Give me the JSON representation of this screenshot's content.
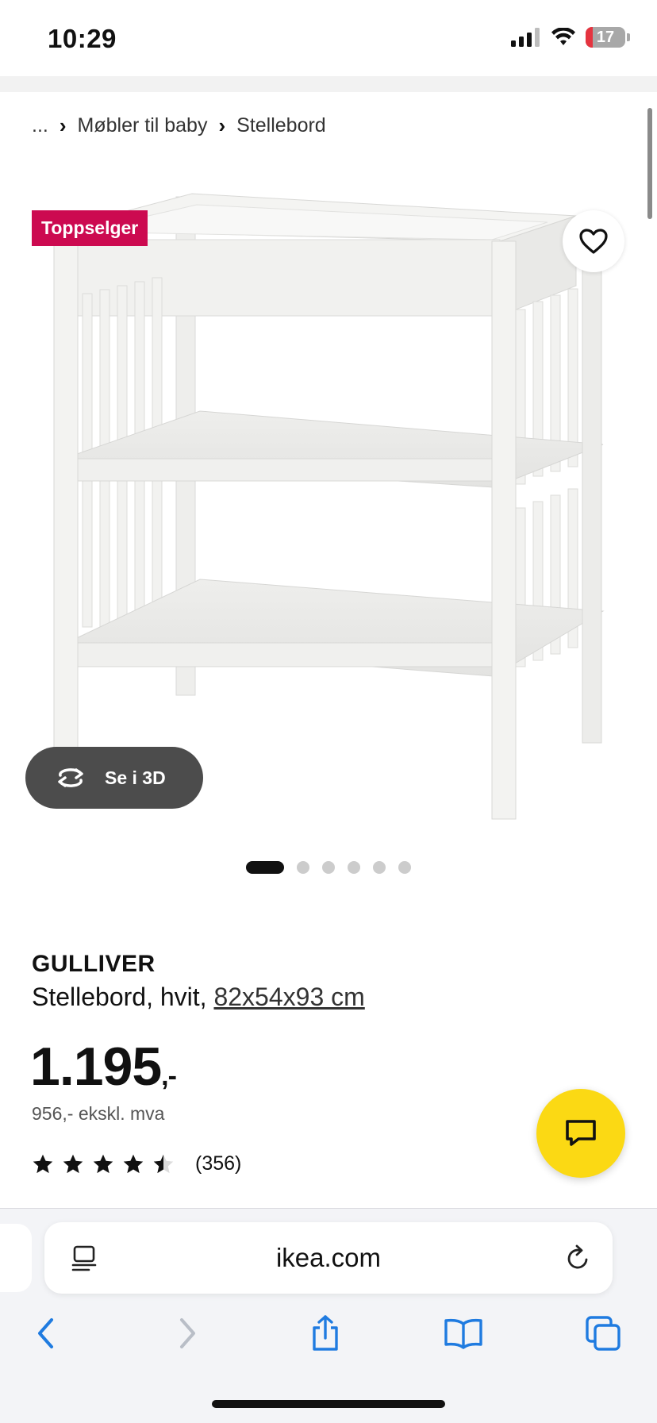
{
  "status_bar": {
    "time": "10:29",
    "battery": "17",
    "battery_fraction": 0.17
  },
  "breadcrumb": {
    "ellipsis": "...",
    "items": [
      "Møbler til baby",
      "Stellebord"
    ]
  },
  "product": {
    "badge": "Toppselger",
    "view_3d_label": "Se i 3D",
    "image_count": 6,
    "active_image": 1,
    "name": "GULLIVER",
    "description": "Stellebord, hvit, ",
    "dimensions": "82x54x93 cm",
    "price_main": "1.195",
    "price_suffix": ",-",
    "price_ex_vat": "956,- ekskl. mva",
    "rating": 4.5,
    "rating_max": 5,
    "review_count": "(356)"
  },
  "browser": {
    "url": "ikea.com"
  },
  "colors": {
    "badge": "#cc0a50",
    "chat_button": "#fbd914",
    "battery_low": "#e5343f"
  },
  "icons": [
    "heart-icon",
    "rotate-3d-icon",
    "chat-icon",
    "reader-icon",
    "reload-icon",
    "back-icon",
    "forward-icon",
    "share-icon",
    "bookmarks-icon",
    "tabs-icon"
  ]
}
